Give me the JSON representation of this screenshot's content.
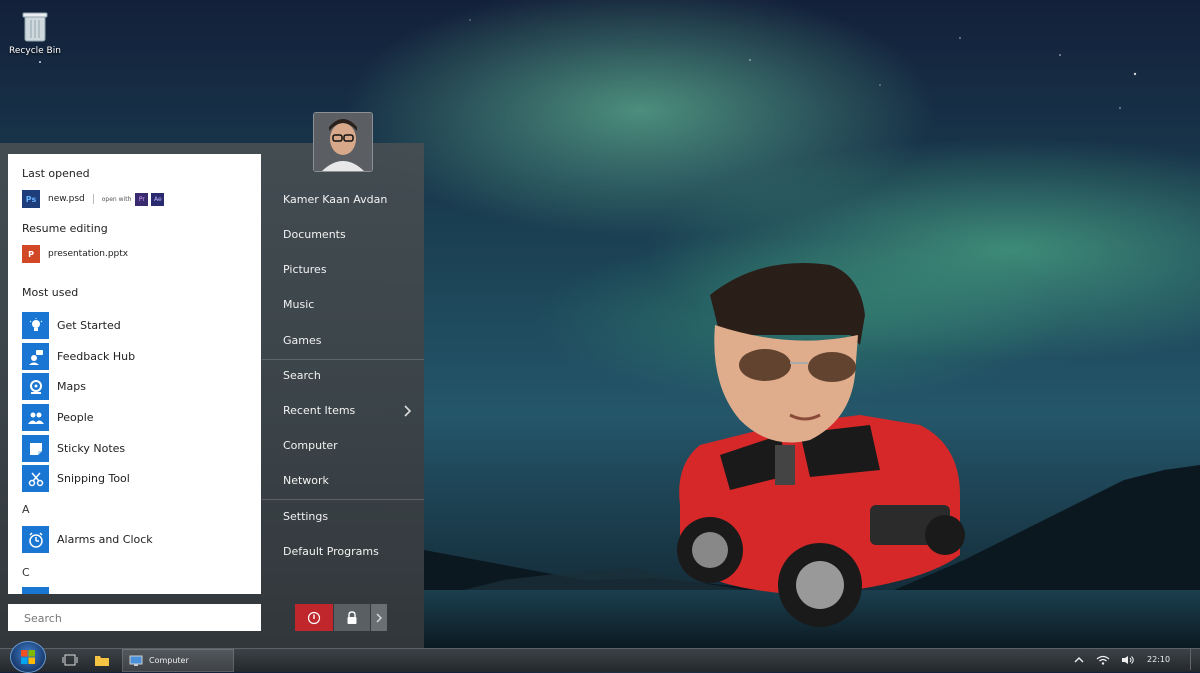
{
  "desktop": {
    "recycle_bin_label": "Recycle Bin"
  },
  "start_menu": {
    "last_opened_heading": "Last opened",
    "last_opened_file": "new.psd",
    "last_opened_icon": "Ps",
    "open_with_label": "open with",
    "open_with_apps": [
      "Pr",
      "Ae"
    ],
    "resume_heading": "Resume editing",
    "resume_file": "presentation.pptx",
    "resume_icon": "P",
    "most_used_heading": "Most used",
    "most_used": [
      {
        "label": "Get Started",
        "icon": "lightbulb-icon"
      },
      {
        "label": "Feedback Hub",
        "icon": "feedback-icon"
      },
      {
        "label": "Maps",
        "icon": "maps-icon"
      },
      {
        "label": "People",
        "icon": "people-icon"
      },
      {
        "label": "Sticky Notes",
        "icon": "sticky-notes-icon"
      },
      {
        "label": "Snipping Tool",
        "icon": "scissors-icon"
      }
    ],
    "letter_a": "A",
    "alarms_label": "Alarms and Clock",
    "letter_c": "C",
    "search_placeholder": "Search",
    "user_name": "Kamer Kaan Avdan",
    "right_items": [
      "Documents",
      "Pictures",
      "Music",
      "Games",
      "Search",
      "Recent Items",
      "Computer",
      "Network",
      "Settings",
      "Default Programs"
    ]
  },
  "taskbar": {
    "computer_label": "Computer",
    "time": "22:10"
  },
  "colors": {
    "accent": "#1976d2",
    "power": "#c0272d",
    "powerpoint": "#d24726"
  }
}
